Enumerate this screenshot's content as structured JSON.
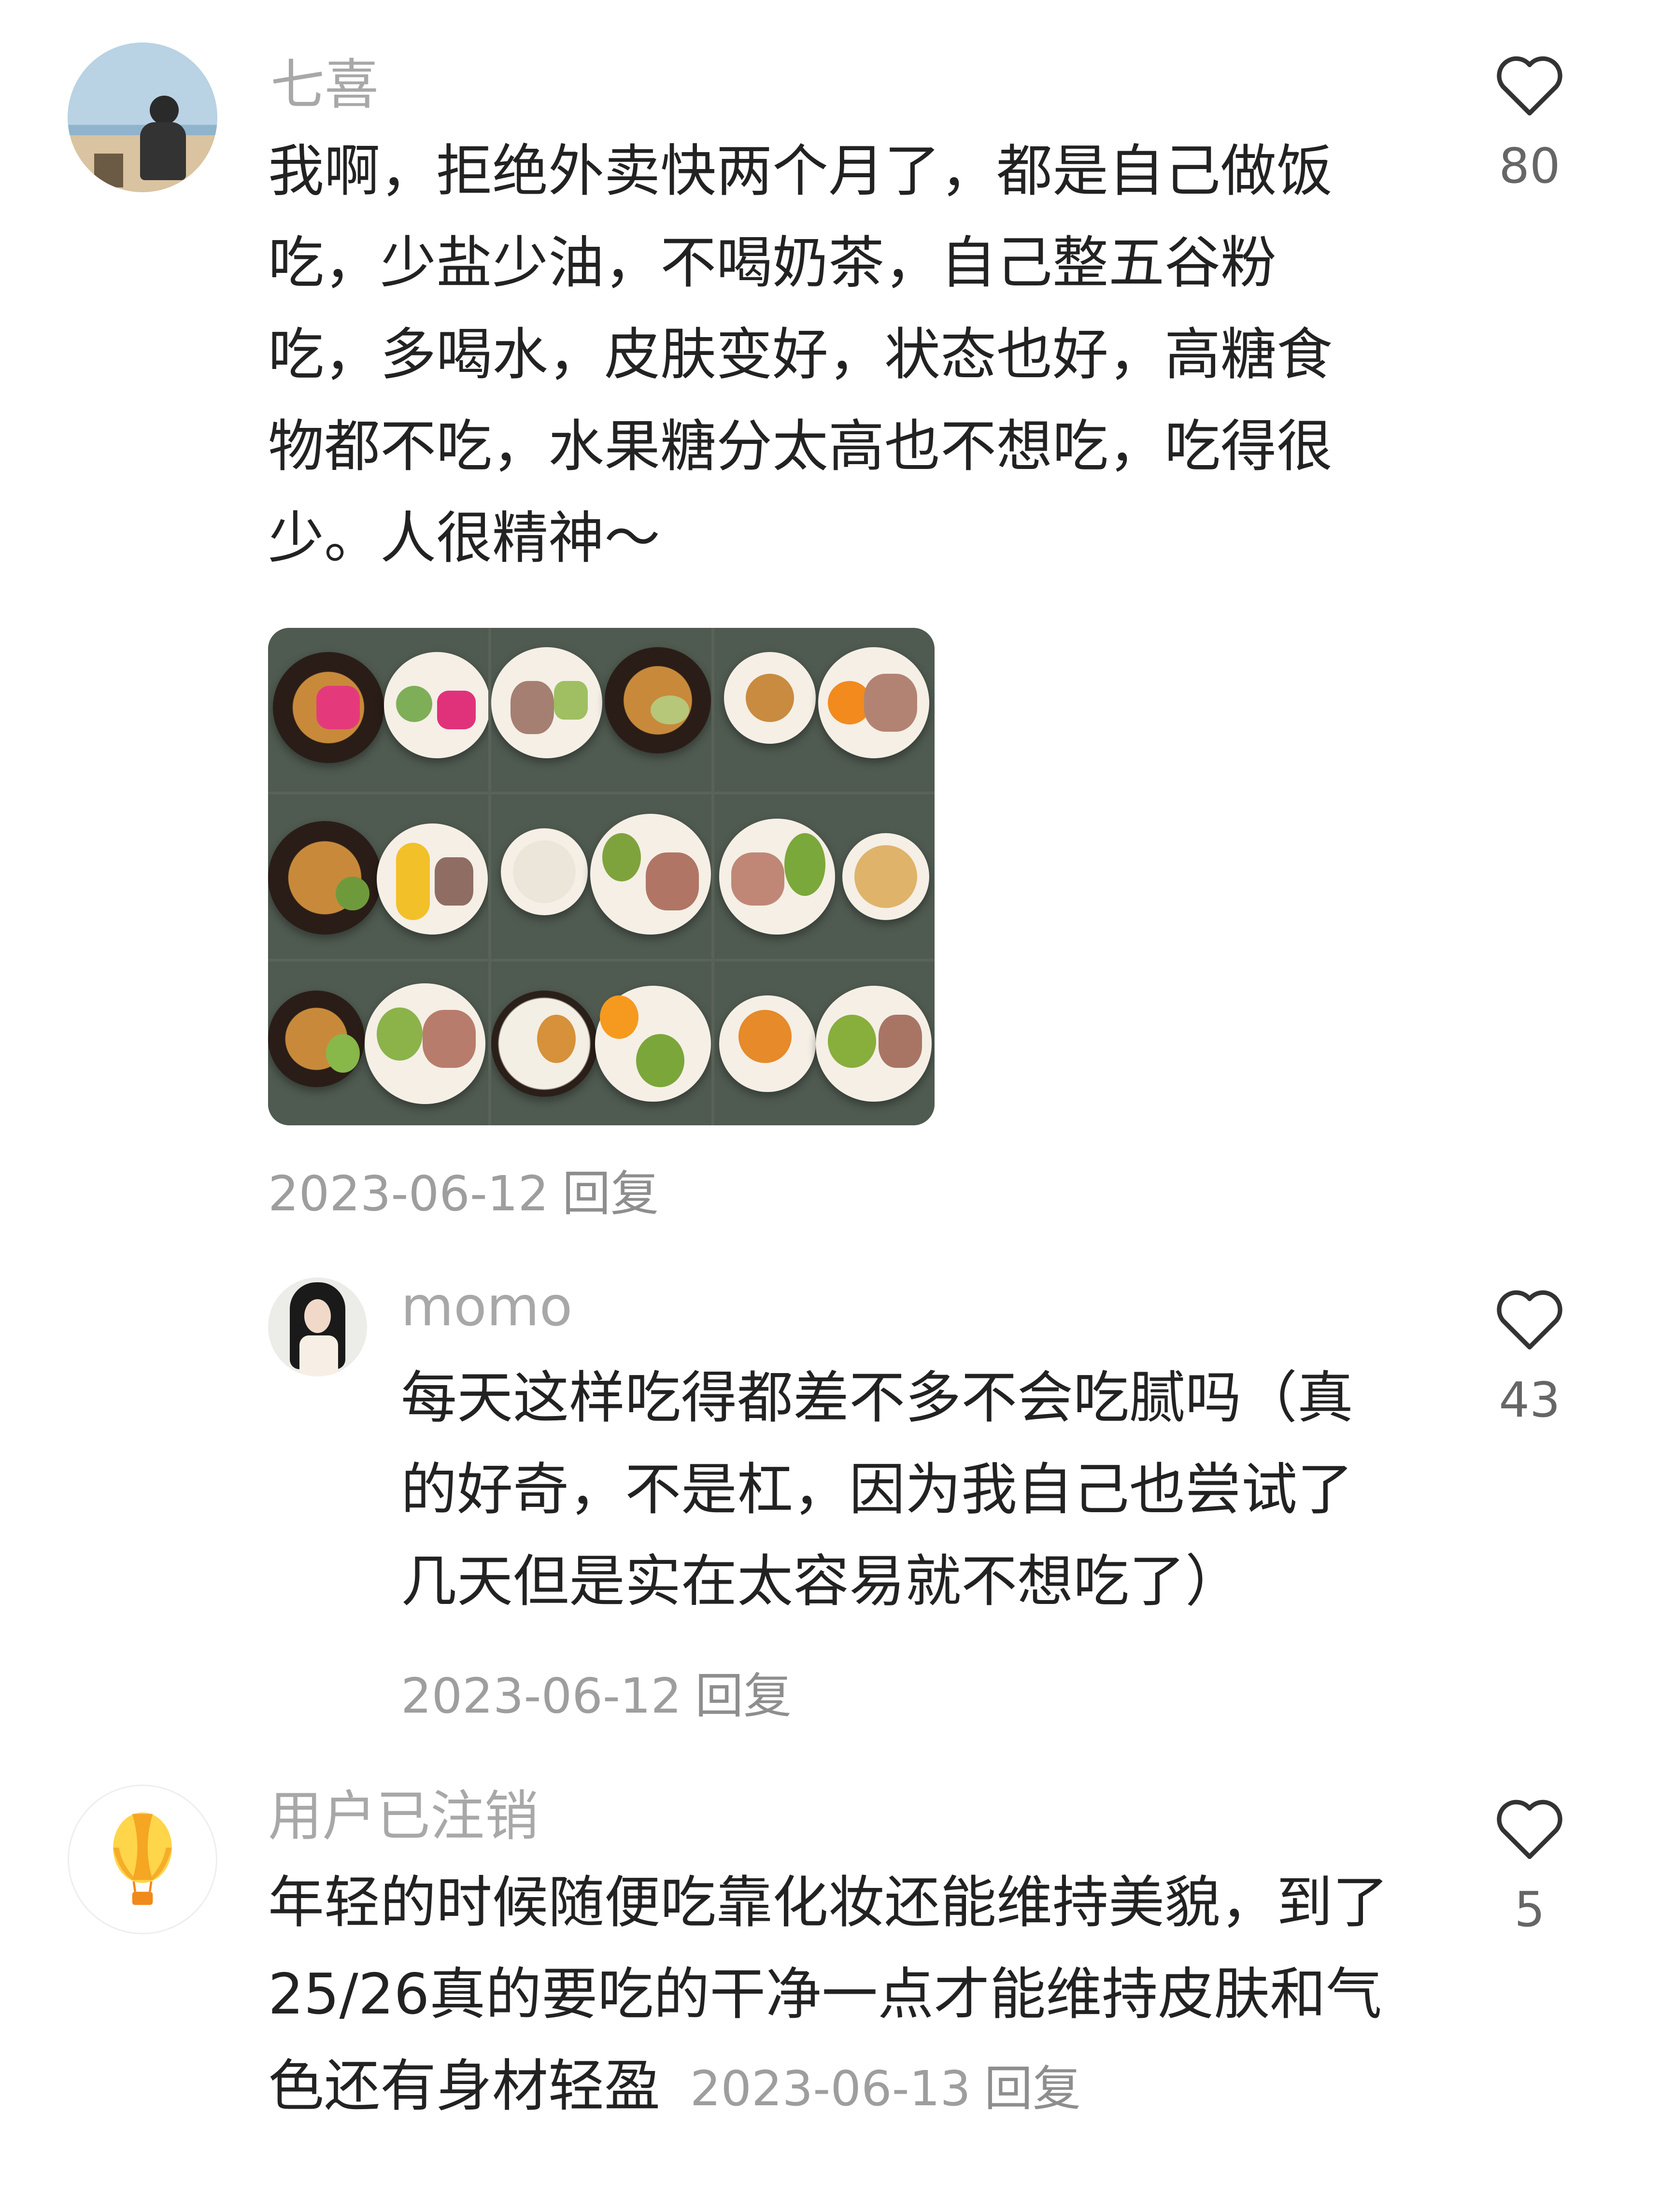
{
  "comments": [
    {
      "user": "七喜",
      "text": "我啊，拒绝外卖快两个月了，都是自己做饭吃，少盐少油，不喝奶茶，自己整五谷粉吃，多喝水，皮肤变好，状态也好，高糖食物都不吃，水果糖分太高也不想吃，吃得很少。人很精神～",
      "date": "2023-06-12",
      "reply_label": "回复",
      "likes": "80",
      "has_image": true
    },
    {
      "user": "momo",
      "text": "每天这样吃得都差不多不会吃腻吗（真的好奇，不是杠，因为我自己也尝试了几天但是实在太容易就不想吃了）",
      "date": "2023-06-12",
      "reply_label": "回复",
      "likes": "43"
    },
    {
      "user": "用户已注销",
      "text": "年轻的时候随便吃靠化妆还能维持美貌，到了25/26真的要吃的干净一点才能维持皮肤和气色还有身材轻盈",
      "date": "2023-06-13",
      "reply_label": "回复",
      "likes": "5"
    }
  ],
  "icons": {
    "like": "heart-outline-icon",
    "avatar3": "hot-air-balloon-icon"
  },
  "colors": {
    "username": "#a8a8a8",
    "meta": "#9e9e9e",
    "balloon_orange": "#f5a623",
    "balloon_yellow": "#ffd54a"
  }
}
